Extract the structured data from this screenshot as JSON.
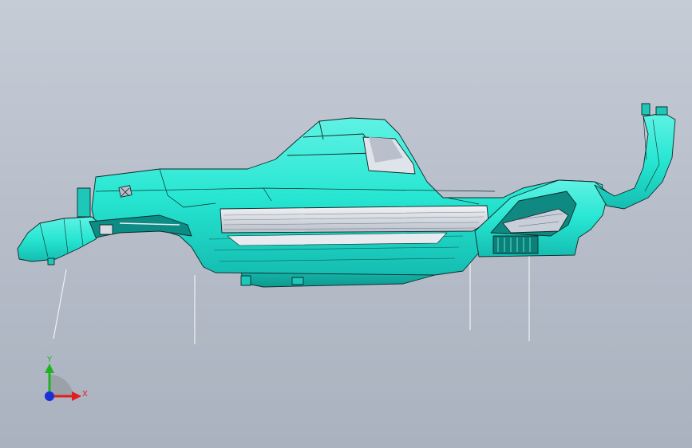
{
  "view": {
    "background_top": "#c6ccd6",
    "background_bottom": "#aab2bf",
    "part_color": "#27e6d2",
    "part_shadow": "#12b8ad",
    "part_highlight": "#6ff5e8",
    "edge_color": "#0c2a28",
    "metal_color": "#d9dde4"
  },
  "triad": {
    "y_label": "Y",
    "x_label": "X",
    "y_color": "#1fb41f",
    "x_color": "#e02020",
    "z_color": "#1a2fd6"
  },
  "leader_lines": {
    "count": 4,
    "color": "#eef1f5"
  }
}
